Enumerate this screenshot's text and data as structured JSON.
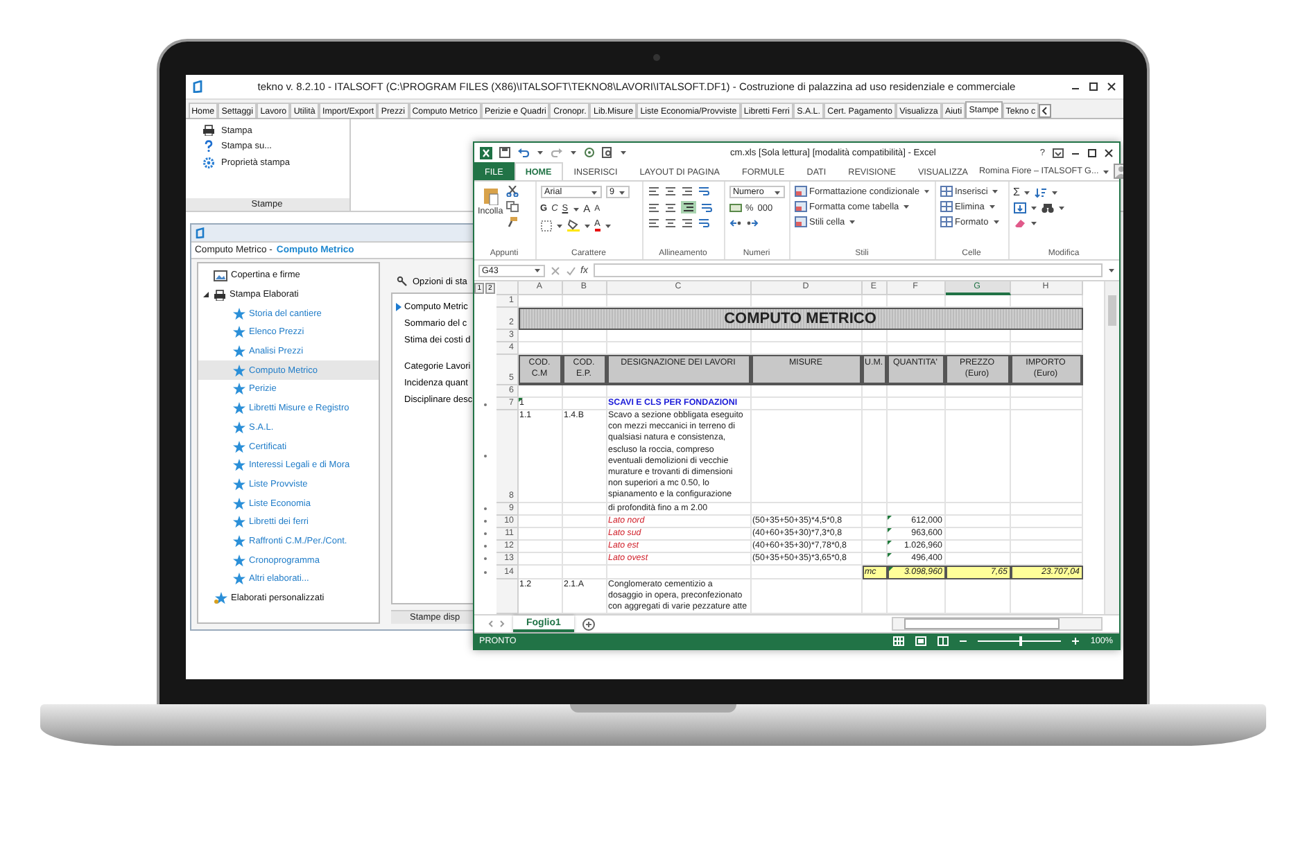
{
  "tekno": {
    "title": "tekno v. 8.2.10 - ITALSOFT (C:\\PROGRAM FILES (X86)\\ITALSOFT\\TEKNO8\\LAVORI\\ITALSOFT.DF1) - Costruzione di palazzina ad uso residenziale e commerciale",
    "tabs": [
      {
        "label": "Home",
        "selected": false
      },
      {
        "label": "Settaggi",
        "selected": false
      },
      {
        "label": "Lavoro",
        "selected": false
      },
      {
        "label": "Utilità",
        "selected": false
      },
      {
        "label": "Import/Export",
        "selected": false
      },
      {
        "label": "Prezzi",
        "selected": false
      },
      {
        "label": "Computo Metrico",
        "selected": false
      },
      {
        "label": "Perizie e Quadri",
        "selected": false
      },
      {
        "label": "Cronopr.",
        "selected": false
      },
      {
        "label": "Lib.Misure",
        "selected": false
      },
      {
        "label": "Liste Economia/Provviste",
        "selected": false
      },
      {
        "label": "Libretti Ferri",
        "selected": false
      },
      {
        "label": "S.A.L.",
        "selected": false
      },
      {
        "label": "Cert. Pagamento",
        "selected": false
      },
      {
        "label": "Visualizza",
        "selected": false
      },
      {
        "label": "Aiuti",
        "selected": false
      },
      {
        "label": "Stampe",
        "selected": true
      },
      {
        "label": "Tekno c",
        "selected": false
      }
    ],
    "ribbon": {
      "commands": [
        {
          "label": "Stampa",
          "kind": "printer"
        },
        {
          "label": "Stampa su...",
          "kind": "help"
        },
        {
          "label": "Proprietà stampa",
          "kind": "gear"
        }
      ],
      "group": "Stampe"
    },
    "document": {
      "title": "Computo Metrico -",
      "title_link": "Computo Metrico",
      "tree": [
        {
          "label": "Copertina e firme",
          "kind": "cover",
          "selected": false
        },
        {
          "label": "Stampa Elaborati",
          "kind": "printer",
          "selected": false,
          "expanded": true,
          "children": [
            {
              "label": "Storia del cantiere",
              "kind": "star",
              "selected": false
            },
            {
              "label": "Elenco Prezzi",
              "kind": "star",
              "selected": false
            },
            {
              "label": "Analisi Prezzi",
              "kind": "star",
              "selected": false
            },
            {
              "label": "Computo Metrico",
              "kind": "star",
              "selected": true
            },
            {
              "label": "Perizie",
              "kind": "star",
              "selected": false
            },
            {
              "label": "Libretti Misure e Registro",
              "kind": "star",
              "selected": false
            },
            {
              "label": "S.A.L.",
              "kind": "star",
              "selected": false
            },
            {
              "label": "Certificati",
              "kind": "star",
              "selected": false
            },
            {
              "label": "Interessi Legali e di Mora",
              "kind": "star",
              "selected": false
            },
            {
              "label": "Liste Provviste",
              "kind": "star",
              "selected": false
            },
            {
              "label": "Liste Economia",
              "kind": "star",
              "selected": false
            },
            {
              "label": "Libretti dei ferri",
              "kind": "star",
              "selected": false
            },
            {
              "label": "Raffronti C.M./Per./Cont.",
              "kind": "star",
              "selected": false
            },
            {
              "label": "Cronoprogramma",
              "kind": "star",
              "selected": false
            },
            {
              "label": "Altri elaborati...",
              "kind": "star",
              "selected": false
            }
          ]
        },
        {
          "label": "Elaborati personalizzati",
          "kind": "stars",
          "selected": false
        }
      ],
      "options_button": "Opzioni di sta",
      "reports": [
        [
          {
            "label": "Computo Metric",
            "selected": true
          },
          {
            "label": "Sommario del c",
            "selected": false
          },
          {
            "label": "Stima dei costi d",
            "selected": false
          }
        ],
        [
          {
            "label": "Categorie Lavori",
            "selected": false
          },
          {
            "label": "Incidenza quant",
            "selected": false
          },
          {
            "label": "Disciplinare desc",
            "selected": false
          }
        ]
      ],
      "footer": "Stampe disp"
    }
  },
  "excel": {
    "title": "cm.xls  [Sola lettura]  [modalità compatibilità] - Excel",
    "help": "?",
    "tabs": [
      {
        "label": "FILE",
        "kind": "file",
        "selected": false
      },
      {
        "label": "HOME",
        "kind": "tab",
        "selected": true
      },
      {
        "label": "INSERISCI",
        "kind": "tab",
        "selected": false
      },
      {
        "label": "LAYOUT DI PAGINA",
        "kind": "tab",
        "selected": false
      },
      {
        "label": "FORMULE",
        "kind": "tab",
        "selected": false
      },
      {
        "label": "DATI",
        "kind": "tab",
        "selected": false
      },
      {
        "label": "REVISIONE",
        "kind": "tab",
        "selected": false
      },
      {
        "label": "VISUALIZZA",
        "kind": "tab",
        "selected": false
      }
    ],
    "user": "Romina Fiore – ITALSOFT G...",
    "ribbon": {
      "clipboard": {
        "paste": "Incolla",
        "group": "Appunti"
      },
      "font": {
        "name": "Arial",
        "size": "9",
        "bold": "G",
        "italic": "C",
        "underline": "S",
        "grow": "A",
        "shrink": "A",
        "font_colour_letter": "A",
        "group": "Carattere"
      },
      "alignment": {
        "group": "Allineamento"
      },
      "number": {
        "format": "Numero",
        "percent": "%",
        "thousands": "000",
        "group": "Numeri"
      },
      "styles": {
        "commands": [
          "Formattazione condizionale",
          "Formatta come tabella",
          "Stili cella"
        ],
        "group": "Stili"
      },
      "cells": {
        "commands": [
          "Inserisci",
          "Elimina",
          "Formato"
        ],
        "group": "Celle"
      },
      "editing": {
        "sum": "Σ",
        "group": "Modifica"
      }
    },
    "name_box": "G43",
    "function_label": "fx",
    "outline_levels": [
      "1",
      "2"
    ],
    "columns": [
      {
        "label": "A",
        "selected": false
      },
      {
        "label": "B",
        "selected": false
      },
      {
        "label": "C",
        "selected": false
      },
      {
        "label": "D",
        "selected": false
      },
      {
        "label": "E",
        "selected": false
      },
      {
        "label": "F",
        "selected": false
      },
      {
        "label": "G",
        "selected": true
      },
      {
        "label": "H",
        "selected": false
      }
    ],
    "rows": [
      {
        "number": "1",
        "kind": "blank"
      },
      {
        "number": "2",
        "kind": "title",
        "text": "COMPUTO METRICO"
      },
      {
        "number": "3",
        "kind": "blank"
      },
      {
        "number": "4",
        "kind": "blank"
      },
      {
        "number": "5",
        "kind": "header",
        "cells": [
          "COD. C.M",
          "COD. E.P.",
          "DESIGNAZIONE DEI LAVORI",
          "MISURE",
          "U.M.",
          "QUANTITA'",
          "PREZZO (Euro)",
          "IMPORTO (Euro)"
        ]
      },
      {
        "number": "6",
        "kind": "blank"
      },
      {
        "number": "7",
        "kind": "section",
        "code_cm": "1",
        "description": "SCAVI E CLS PER FONDAZIONI",
        "outlined": true,
        "flag": true
      },
      {
        "number": "8",
        "kind": "item",
        "code_cm": "1.1",
        "code_ep": "1.4.B",
        "description": "Scavo a sezione obbligata eseguito con mezzi meccanici in terreno di qualsiasi natura e consistenza, escluso la roccia, compreso eventuali demolizioni di vecchie murature e trovanti di dimensioni non superiori a mc 0.50, lo spianamento e la configurazione",
        "outlined": true
      },
      {
        "number": "9",
        "kind": "item",
        "description": "di profondità fino a m 2.00",
        "outlined": true
      },
      {
        "number": "10",
        "kind": "measure",
        "description": "Lato nord",
        "measure": "(50+35+50+35)*4,5*0,8",
        "quantity": "612,000",
        "outlined": true,
        "flag": true
      },
      {
        "number": "11",
        "kind": "measure",
        "description": "Lato sud",
        "measure": "(40+60+35+30)*7,3*0,8",
        "quantity": "963,600",
        "outlined": true,
        "flag": true
      },
      {
        "number": "12",
        "kind": "measure",
        "description": "Lato est",
        "measure": "(40+60+35+30)*7,78*0,8",
        "quantity": "1.026,960",
        "outlined": true,
        "flag": true
      },
      {
        "number": "13",
        "kind": "measure",
        "description": "Lato ovest",
        "measure": "(50+35+50+35)*3,65*0,8",
        "quantity": "496,400",
        "outlined": true,
        "flag": true
      },
      {
        "number": "14",
        "kind": "total",
        "unit": "mc",
        "quantity": "3.098,960",
        "price": "7,65",
        "amount": "23.707,04",
        "outlined": true,
        "flag": true
      },
      {
        "kind": "item",
        "code_cm": "1.2",
        "code_ep": "2.1.A",
        "description": "Conglomerato cementizio a dosaggio in opera, preconfezionato con aggregati di varie pezzature atte",
        "outlined": false
      }
    ],
    "sheets": [
      {
        "label": "Foglio1",
        "selected": true
      }
    ],
    "status": "PRONTO",
    "zoom": {
      "level": 0.5,
      "reading": "100%"
    }
  }
}
